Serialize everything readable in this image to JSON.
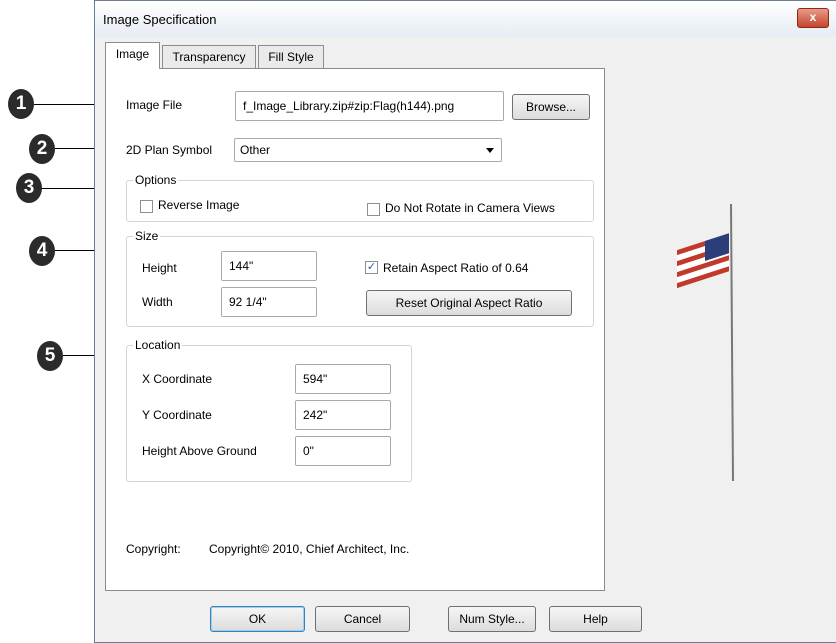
{
  "dialog": {
    "title": "Image Specification",
    "close_glyph": "x",
    "tabs": [
      "Image",
      "Transparency",
      "Fill Style"
    ]
  },
  "callouts": [
    "1",
    "2",
    "3",
    "4",
    "5"
  ],
  "image_file": {
    "label": "Image File",
    "value": "f_Image_Library.zip#zip:Flag(h144).png",
    "browse": "Browse..."
  },
  "plan_symbol": {
    "label": "2D Plan Symbol",
    "value": "Other"
  },
  "options": {
    "legend": "Options",
    "reverse_image": "Reverse Image",
    "do_not_rotate": "Do Not Rotate in Camera Views"
  },
  "size": {
    "legend": "Size",
    "height_label": "Height",
    "height_value": "144\"",
    "width_label": "Width",
    "width_value": "92 1/4\"",
    "retain_aspect": "Retain Aspect Ratio of 0.64",
    "reset_button": "Reset Original Aspect Ratio"
  },
  "location": {
    "legend": "Location",
    "x_label": "X Coordinate",
    "x_value": "594\"",
    "y_label": "Y Coordinate",
    "y_value": "242\"",
    "h_label": "Height Above Ground",
    "h_value": "0\""
  },
  "copyright": {
    "label": "Copyright:",
    "value": "Copyright© 2010, Chief Architect, Inc."
  },
  "buttons": {
    "ok": "OK",
    "cancel": "Cancel",
    "num_style": "Num Style...",
    "help": "Help"
  },
  "icons": {
    "close": "close-icon",
    "dropdown": "chevron-down-icon",
    "check": "checkmark-icon",
    "preview": "flag-preview"
  },
  "colors": {
    "callout": "#2b2b2b",
    "close_button": "#c4452d",
    "flag_red": "#c0392b",
    "flag_blue": "#2c3e7a"
  },
  "checkboxes": {
    "reverse_image": false,
    "do_not_rotate": false,
    "retain_aspect": true
  }
}
